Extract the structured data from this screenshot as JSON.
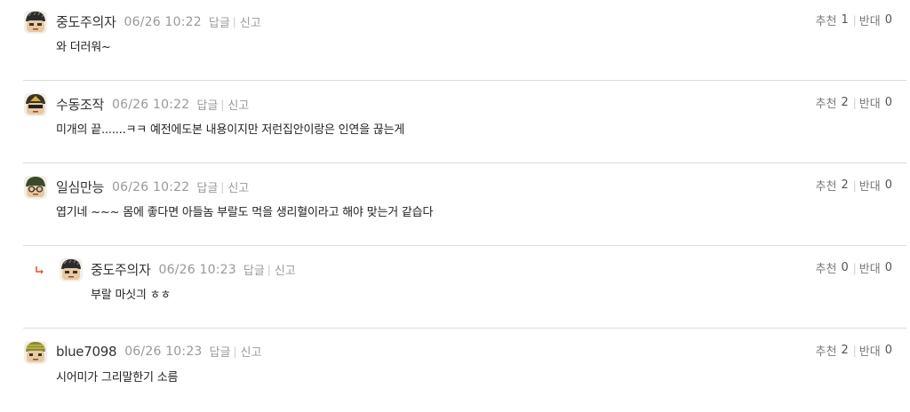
{
  "comments": [
    {
      "nickname": "중도주의자",
      "datetime": "06/26 10:22",
      "reply_label": "답글",
      "report_label": "신고",
      "text": "와 더러워~",
      "recommend_label": "추천",
      "recommend_count": "1",
      "oppose_label": "반대",
      "oppose_count": "0",
      "avatar_helmet_color": "#2b2b2b"
    },
    {
      "nickname": "수동조작",
      "datetime": "06/26 10:22",
      "reply_label": "답글",
      "report_label": "신고",
      "text": "미개의 끝.......ㅋㅋ 예전에도본 내용이지만 저런집안이랑은 인연을 끊는게",
      "recommend_label": "추천",
      "recommend_count": "2",
      "oppose_label": "반대",
      "oppose_count": "0",
      "avatar_helmet_color": "#3a3320"
    },
    {
      "nickname": "일심만능",
      "datetime": "06/26 10:22",
      "reply_label": "답글",
      "report_label": "신고",
      "text": "엽기네 ~~~ 몸에 좋다면 아들놈 부랄도 먹을 생리혈이라고 해야 맞는거 같습다",
      "recommend_label": "추천",
      "recommend_count": "2",
      "oppose_label": "반대",
      "oppose_count": "0",
      "avatar_helmet_color": "#3b4a2a"
    },
    {
      "nickname": "중도주의자",
      "datetime": "06/26 10:23",
      "reply_label": "답글",
      "report_label": "신고",
      "text": "부랄 마싯긔 ㅎㅎ",
      "recommend_label": "추천",
      "recommend_count": "0",
      "oppose_label": "반대",
      "oppose_count": "0",
      "avatar_helmet_color": "#2b2b2b",
      "is_reply": true
    },
    {
      "nickname": "blue7098",
      "datetime": "06/26 10:23",
      "reply_label": "답글",
      "report_label": "신고",
      "text": "시어미가 그리말한기 소름",
      "recommend_label": "추천",
      "recommend_count": "2",
      "oppose_label": "반대",
      "oppose_count": "0",
      "avatar_helmet_color": "#8a8a2a"
    }
  ],
  "colors": {
    "reply_arrow": "#e0562a",
    "separator": "#dcdcdc",
    "meta_text": "#999999"
  },
  "icons": {
    "reply_indicator": "reply-arrow-icon",
    "avatar": "avatar-icon"
  }
}
